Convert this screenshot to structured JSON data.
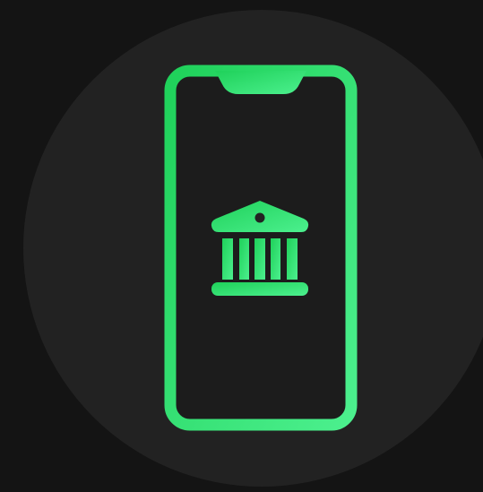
{
  "illustration": {
    "subject": "mobile-banking-icon",
    "icons": [
      "smartphone-outline-icon",
      "bank-building-icon"
    ]
  },
  "colors": {
    "page_background": "#141414",
    "circle_background": "#222222",
    "phone_inner": "#1c1c1c",
    "accent_green_dark": "#1fd15a",
    "accent_green_light": "#4cf08e"
  }
}
